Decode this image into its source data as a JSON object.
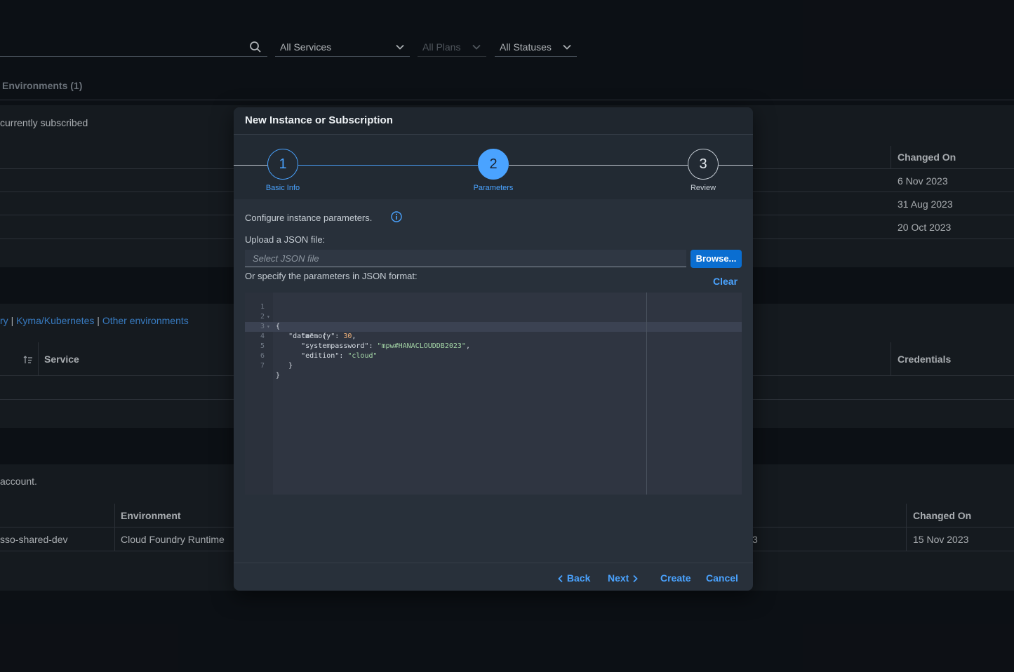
{
  "toolbar": {
    "service_filter": "All Services",
    "plan_filter": "All Plans",
    "status_filter": "All Statuses"
  },
  "tabs": {
    "environments": "Environments (1)"
  },
  "subscriptions": {
    "empty_text": "currently subscribed",
    "changed_on_header": "Changed On",
    "rows": [
      "6 Nov 2023",
      "31 Aug 2023",
      "20 Oct 2023"
    ]
  },
  "instances": {
    "env_links": {
      "cf_partial": "ry",
      "sep1": "|",
      "kyma": "Kyma/Kubernetes",
      "sep2": "|",
      "other": "Other environments"
    },
    "service_header": "Service",
    "credentials_header": "Credentials"
  },
  "environments": {
    "account_text": "account.",
    "env_header": "Environment",
    "changed_on_header": "Changed On",
    "row": {
      "name": "sso-shared-dev",
      "environment": "Cloud Foundry Runtime",
      "partial": "3",
      "changed_on": "15 Nov 2023"
    }
  },
  "dialog": {
    "title": "New Instance or Subscription",
    "steps": [
      {
        "number": "1",
        "label": "Basic Info"
      },
      {
        "number": "2",
        "label": "Parameters"
      },
      {
        "number": "3",
        "label": "Review"
      }
    ],
    "configure_text": "Configure instance parameters.",
    "upload_label": "Upload a JSON file:",
    "file_placeholder": "Select JSON file",
    "browse_label": "Browse...",
    "specify_label": "Or specify the parameters in JSON format:",
    "clear_label": "Clear",
    "code": {
      "line_numbers": [
        "1",
        "2",
        "3",
        "4",
        "5",
        "6",
        "7"
      ],
      "l1": "{",
      "l2_key": "\"data\"",
      "l2_rest": ": {",
      "l3_key": "\"memory\"",
      "l3_val": "30",
      "l4_key": "\"systempassword\"",
      "l4_val": "\"mpw#HANACLOUDDB2023\"",
      "l5_key": "\"edition\"",
      "l5_val": "\"cloud\"",
      "l6": "}",
      "l7": "}"
    },
    "footer": {
      "back": "Back",
      "next": "Next",
      "create": "Create",
      "cancel": "Cancel"
    },
    "colors": {
      "accent": "#4aa3ff",
      "button": "#0a6ed1"
    }
  }
}
